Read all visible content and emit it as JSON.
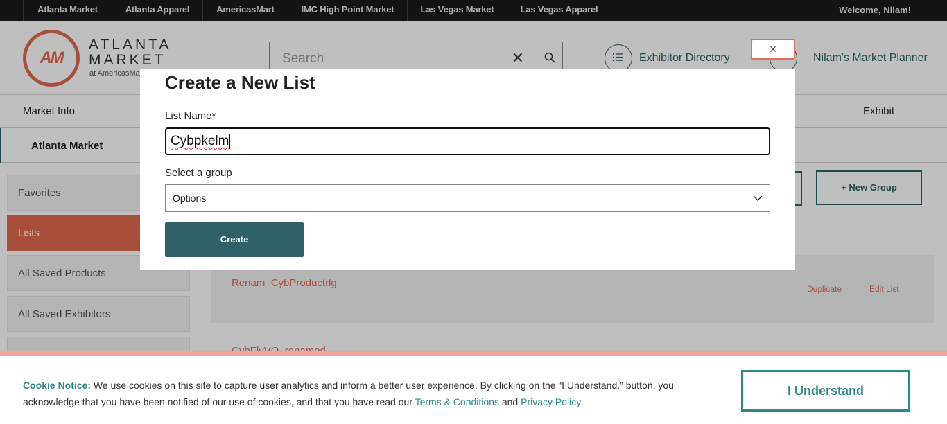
{
  "topnav": {
    "items": [
      "Atlanta Market",
      "Atlanta Apparel",
      "AmericasMart",
      "IMC High Point Market",
      "Las Vegas Market",
      "Las Vegas Apparel"
    ],
    "welcome": "Welcome, Nilam!"
  },
  "header": {
    "logo_top": "ATLANTA",
    "logo_bottom": "MARKET",
    "logo_sub": "at AmericasMa",
    "logo_mark": "AM",
    "search_placeholder": "Search",
    "exhibitor_directory": "Exhibitor Directory",
    "market_planner": "Nilam's Market Planner"
  },
  "mainnav": {
    "left": "Market Info",
    "right": "Exhibit"
  },
  "subnav": {
    "title": "Atlanta Market"
  },
  "sidebar": {
    "items": [
      "Favorites",
      "Lists",
      "All Saved Products",
      "All Saved Exhibitors",
      "All Events And Seminars"
    ]
  },
  "content": {
    "new_group": "+ New Group",
    "row1_name": "Renam_CybProductrlg",
    "duplicate": "Duplicate",
    "edit_list": "Edit List",
    "row2_name": "CybFlyVO_renamed"
  },
  "modal": {
    "title": "Create a New List",
    "name_label": "List Name*",
    "name_value": "Cybpkelm",
    "group_label": "Select a group",
    "group_value": "Options",
    "create_label": "Create",
    "close_symbol": "×"
  },
  "cookie": {
    "notice_label": "Cookie Notice:",
    "text_1": " We use cookies on this site to capture user analytics and inform a better user experience. By clicking on the “I Understand.” button, you acknowledge that you have been notified of our use of cookies, and that you have read our ",
    "terms": "Terms & Conditions",
    "and": " and ",
    "privacy": "Privacy Policy",
    "period": ".",
    "button": "I Understand"
  }
}
